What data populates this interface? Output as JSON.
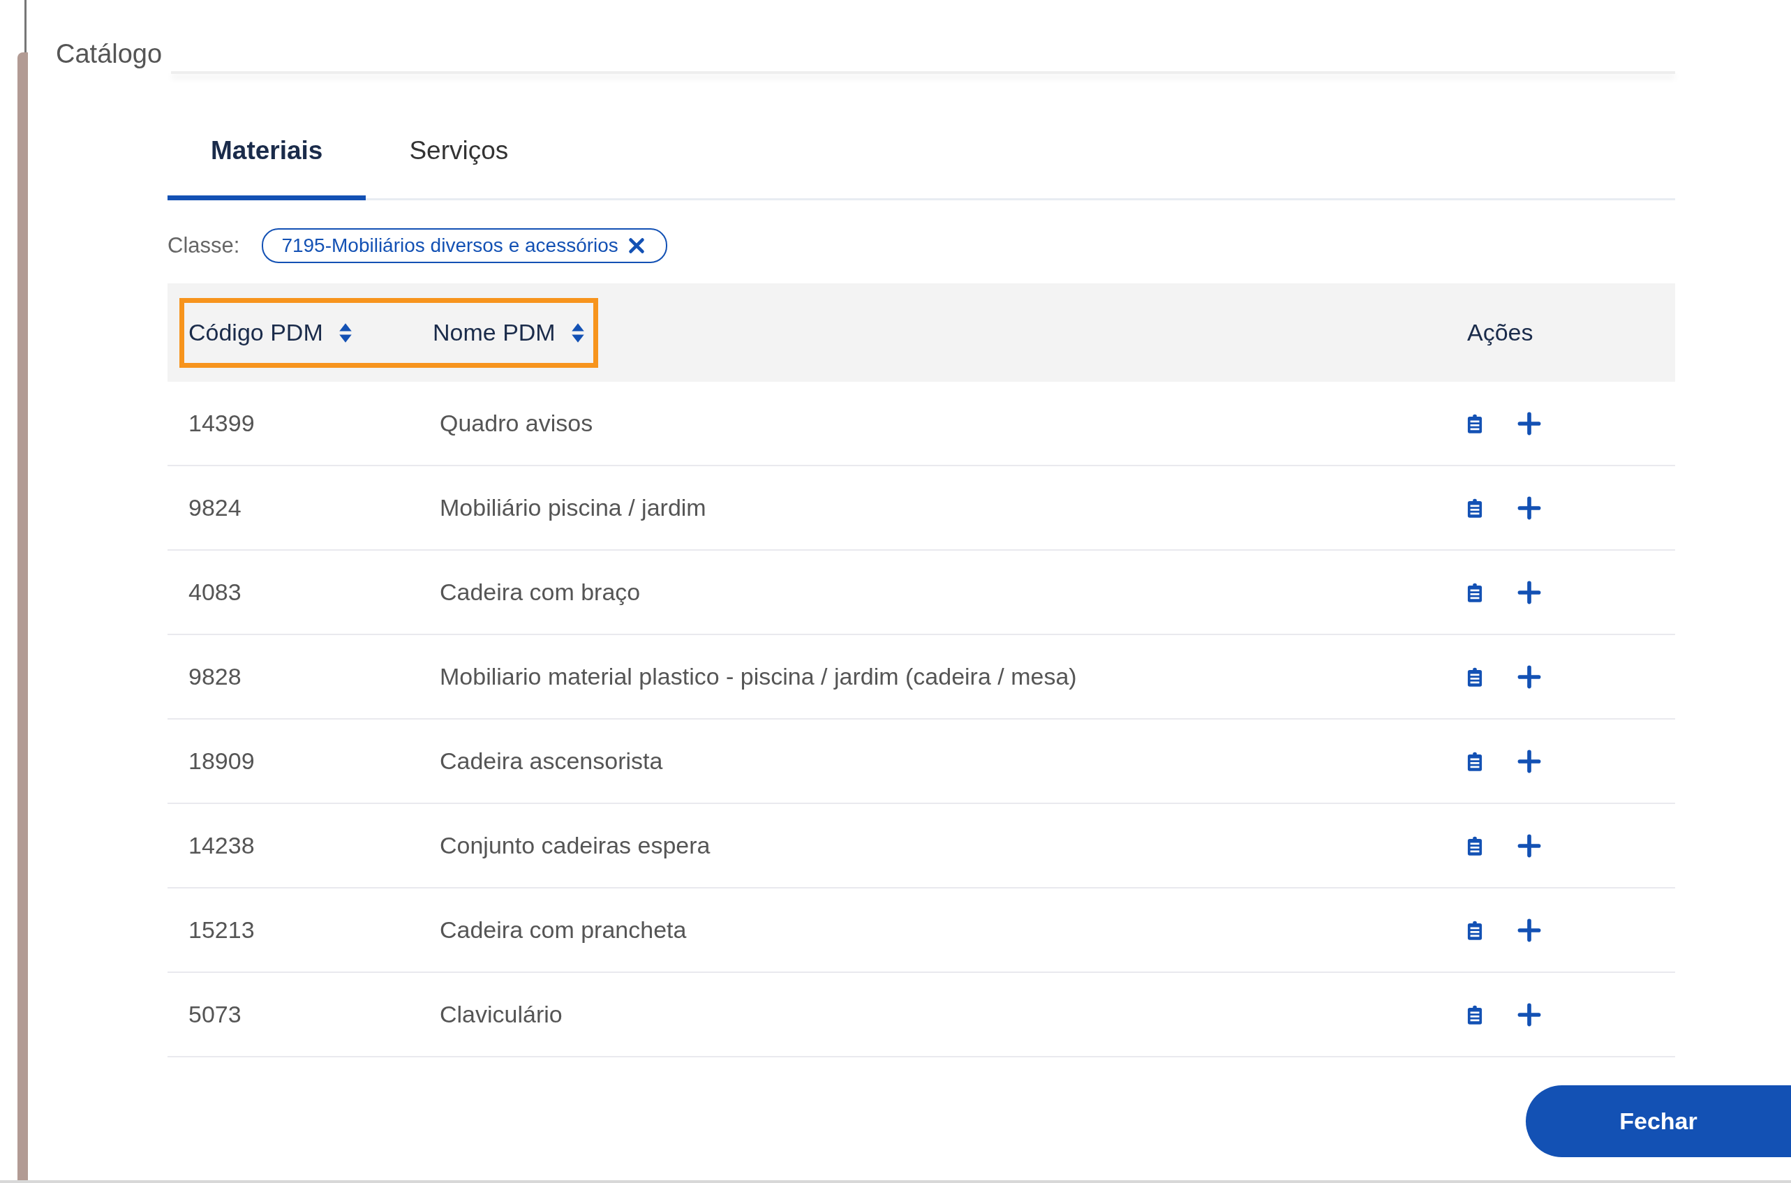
{
  "title": "Catálogo",
  "tabs": [
    {
      "label": "Materiais",
      "selected": true
    },
    {
      "label": "Serviços",
      "selected": false
    }
  ],
  "filter": {
    "label": "Classe:",
    "chip": "7195-Mobiliários diversos e acessórios"
  },
  "table": {
    "columns": [
      {
        "label": "Código PDM",
        "kind": "sortable",
        "highlighted": true
      },
      {
        "label": "Nome PDM",
        "kind": "sortable",
        "highlighted": true
      },
      {
        "label": "Ações",
        "kind": "plain",
        "highlighted": false
      }
    ],
    "rows": [
      {
        "code": "14399",
        "name": "Quadro avisos"
      },
      {
        "code": "9824",
        "name": "Mobiliário piscina / jardim"
      },
      {
        "code": "4083",
        "name": "Cadeira com braço"
      },
      {
        "code": "9828",
        "name": "Mobiliario material plastico - piscina / jardim (cadeira / mesa)"
      },
      {
        "code": "18909",
        "name": "Cadeira ascensorista"
      },
      {
        "code": "14238",
        "name": "Conjunto cadeiras espera"
      },
      {
        "code": "15213",
        "name": "Cadeira com prancheta"
      },
      {
        "code": "5073",
        "name": "Claviculário"
      }
    ]
  },
  "close_button": "Fechar"
}
